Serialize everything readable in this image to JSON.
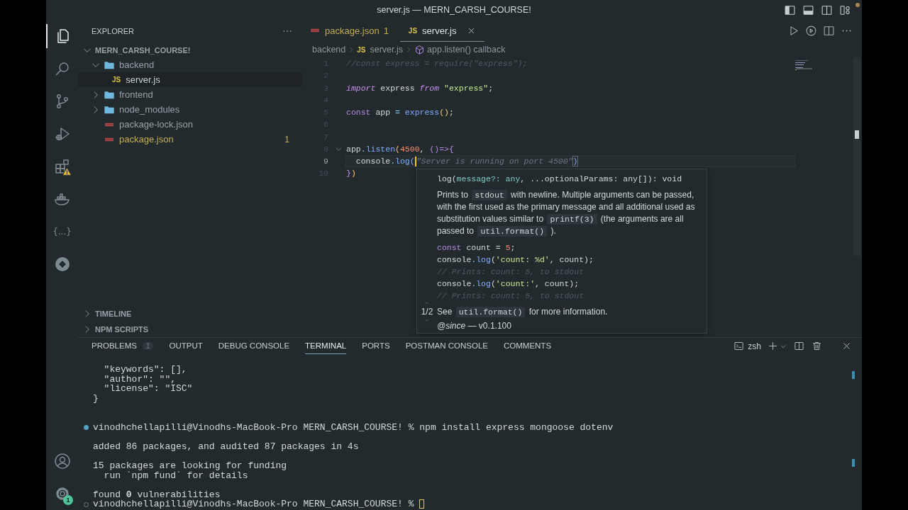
{
  "window": {
    "title": "server.js — MERN_CARSH_COURSE!"
  },
  "activity_bar": {
    "items": [
      {
        "kind": "explorer",
        "selected": true
      },
      {
        "kind": "search",
        "selected": false
      },
      {
        "kind": "source-control",
        "selected": false
      },
      {
        "kind": "run-debug",
        "selected": false
      },
      {
        "kind": "extensions",
        "selected": false,
        "warning": true
      },
      {
        "kind": "docker",
        "selected": false
      },
      {
        "kind": "braces",
        "label": "{...}",
        "selected": false
      },
      {
        "kind": "gitlens",
        "selected": false
      }
    ],
    "bottom": [
      {
        "kind": "account"
      },
      {
        "kind": "settings",
        "badge": "1"
      }
    ]
  },
  "sidebar": {
    "title": "EXPLORER",
    "root": {
      "label": "MERN_CARSH_COURSE!",
      "expanded": true,
      "children": [
        {
          "label": "backend",
          "kind": "folder",
          "expanded": true,
          "selected": false,
          "children": [
            {
              "label": "server.js",
              "kind": "js",
              "icon_label": "JS",
              "selected": true
            }
          ]
        },
        {
          "label": "frontend",
          "kind": "folder",
          "expanded": false,
          "selected": false
        },
        {
          "label": "node_modules",
          "kind": "folder",
          "expanded": false,
          "selected": false
        },
        {
          "label": "package-lock.json",
          "kind": "json",
          "selected": false
        },
        {
          "label": "package.json",
          "kind": "json",
          "selected": false,
          "problem": true,
          "badge": "1"
        }
      ]
    },
    "sections": [
      {
        "label": "TIMELINE",
        "expanded": false
      },
      {
        "label": "NPM SCRIPTS",
        "expanded": false
      }
    ]
  },
  "editor": {
    "tabs": [
      {
        "label": "package.json",
        "kind": "json",
        "badge": "1",
        "problem": true,
        "selected": false
      },
      {
        "label": "server.js",
        "kind": "js",
        "icon_label": "JS",
        "problem": false,
        "selected": true
      }
    ],
    "breadcrumb": [
      {
        "label": "backend",
        "kind": "folder"
      },
      {
        "label": "server.js",
        "kind": "js",
        "icon_label": "JS"
      },
      {
        "label": "app.listen() callback",
        "kind": "symbol"
      }
    ],
    "lines": [
      {
        "number": "1",
        "current": false,
        "tokens": [
          {
            "kind": "comment",
            "text": "//const express = require(\"express\");"
          }
        ]
      },
      {
        "number": "2",
        "current": false
      },
      {
        "number": "3",
        "current": false,
        "tokens": [
          {
            "kind": "keyword",
            "text": "import"
          },
          {
            "kind": "plain",
            "text": " express "
          },
          {
            "kind": "keyword",
            "text": "from"
          },
          {
            "kind": "string",
            "text": " \"express\""
          },
          {
            "kind": "plain",
            "text": ";"
          }
        ]
      },
      {
        "number": "4",
        "current": false
      },
      {
        "number": "5",
        "current": false,
        "tokens": [
          {
            "kind": "storage",
            "text": "const"
          },
          {
            "kind": "plain",
            "text": " app "
          },
          {
            "kind": "punct",
            "text": "="
          },
          {
            "kind": "func",
            "text": " express"
          },
          {
            "kind": "brace",
            "text": "()"
          },
          {
            "kind": "plain",
            "text": ";"
          }
        ]
      },
      {
        "number": "6",
        "current": false
      },
      {
        "number": "7",
        "current": false
      },
      {
        "number": "8",
        "current": false,
        "foldable": true,
        "tokens": [
          {
            "kind": "plain",
            "text": "app"
          },
          {
            "kind": "punct",
            "text": "."
          },
          {
            "kind": "func",
            "text": "listen"
          },
          {
            "kind": "brace",
            "text": "("
          },
          {
            "kind": "number",
            "text": "4500"
          },
          {
            "kind": "plain",
            "text": ", "
          },
          {
            "kind": "storage",
            "text": "()=>"
          },
          {
            "kind": "brace2",
            "text": "{"
          }
        ]
      },
      {
        "number": "9",
        "current": true,
        "tokens": [
          {
            "kind": "plain",
            "text": "  console"
          },
          {
            "kind": "punct",
            "text": "."
          },
          {
            "kind": "func",
            "text": "log"
          },
          {
            "kind": "brace3",
            "text": "("
          },
          {
            "kind": "cursor"
          },
          {
            "kind": "ghost",
            "text": "\"Server is running on port 4500\""
          },
          {
            "kind": "match",
            "text": ")"
          }
        ]
      },
      {
        "number": "10",
        "current": false,
        "tokens": [
          {
            "kind": "brace2",
            "text": "}"
          },
          {
            "kind": "brace",
            "text": ")"
          }
        ]
      }
    ],
    "hover": {
      "pager": "1/2",
      "signature": [
        {
          "kind": "plain",
          "text": "log("
        },
        {
          "kind": "param",
          "text": "message?: any"
        },
        {
          "kind": "plain",
          "text": ", ...optionalParams: any[]): void"
        }
      ],
      "paragraph": [
        {
          "text": "Prints to ",
          "code": false
        },
        {
          "text": "stdout",
          "code": true
        },
        {
          "text": " with newline. Multiple arguments can be passed, with the first used as the primary message and all additional used as substitution values similar to ",
          "code": false
        },
        {
          "text": "printf(3)",
          "code": true
        },
        {
          "text": " (the arguments are all passed to ",
          "code": false
        },
        {
          "text": "util.format()",
          "code": true
        },
        {
          "text": " ).",
          "code": false
        }
      ],
      "example": [
        [
          {
            "kind": "storage",
            "text": "const"
          },
          {
            "kind": "plain",
            "text": " count = "
          },
          {
            "kind": "number",
            "text": "5"
          },
          {
            "kind": "plain",
            "text": ";"
          }
        ],
        [
          {
            "kind": "plain",
            "text": "console"
          },
          {
            "kind": "punct",
            "text": "."
          },
          {
            "kind": "func",
            "text": "log"
          },
          {
            "kind": "plain",
            "text": "("
          },
          {
            "kind": "string",
            "text": "'count: %d'"
          },
          {
            "kind": "plain",
            "text": ", count);"
          }
        ],
        [
          {
            "kind": "comment",
            "text": "// Prints: count: 5, to stdout"
          }
        ],
        [
          {
            "kind": "plain",
            "text": "console"
          },
          {
            "kind": "punct",
            "text": "."
          },
          {
            "kind": "func",
            "text": "log"
          },
          {
            "kind": "plain",
            "text": "("
          },
          {
            "kind": "string",
            "text": "'count:'"
          },
          {
            "kind": "plain",
            "text": ", count);"
          }
        ],
        [
          {
            "kind": "comment",
            "text": "// Prints: count: 5, to stdout"
          }
        ]
      ],
      "see": [
        {
          "text": "See ",
          "code": false
        },
        {
          "text": "util.format()",
          "code": true
        },
        {
          "text": " for more information.",
          "code": false
        }
      ],
      "since": "*@since* — v0.1.100"
    }
  },
  "panel": {
    "tabs": [
      {
        "label": "PROBLEMS",
        "badge": "1",
        "selected": false
      },
      {
        "label": "OUTPUT",
        "selected": false
      },
      {
        "label": "DEBUG CONSOLE",
        "selected": false
      },
      {
        "label": "TERMINAL",
        "selected": true
      },
      {
        "label": "PORTS",
        "selected": false
      },
      {
        "label": "POSTMAN CONSOLE",
        "selected": false
      },
      {
        "label": "COMMENTS",
        "selected": false
      }
    ],
    "shell": "zsh",
    "terminal": [
      {
        "kind": "output",
        "text": "  \"keywords\": [],"
      },
      {
        "kind": "output",
        "text": "  \"author\": \"\","
      },
      {
        "kind": "output",
        "text": "  \"license\": \"ISC\""
      },
      {
        "kind": "output",
        "text": "}"
      },
      {
        "kind": "blank"
      },
      {
        "kind": "blank"
      },
      {
        "kind": "prompt",
        "completed": true,
        "text": "vinodhchellapilli@Vinodhs-MacBook-Pro MERN_CARSH_COURSE! % npm install express mongoose dotenv",
        "cursor": false
      },
      {
        "kind": "blank"
      },
      {
        "kind": "output",
        "text": "added 86 packages, and audited 87 packages in 4s"
      },
      {
        "kind": "blank"
      },
      {
        "kind": "output",
        "text": "15 packages are looking for funding"
      },
      {
        "kind": "output",
        "text": "  run `npm fund` for details"
      },
      {
        "kind": "blank"
      },
      {
        "kind": "output",
        "text": "found **0** vulnerabilities"
      },
      {
        "kind": "prompt",
        "completed": false,
        "text": "vinodhchellapilli@Vinodhs-MacBook-Pro MERN_CARSH_COURSE! %",
        "cursor": true
      }
    ]
  }
}
